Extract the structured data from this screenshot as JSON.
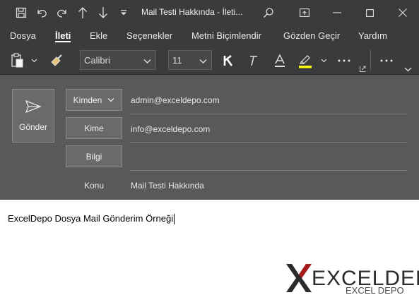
{
  "window": {
    "title": "Mail Testi Hakkında  -  İleti..."
  },
  "menu": {
    "tabs": [
      "Dosya",
      "İleti",
      "Ekle",
      "Seçenekler",
      "Metni Biçimlendir",
      "Gözden Geçir",
      "Yardım"
    ],
    "active": "İleti"
  },
  "ribbon": {
    "font_name": "Calibri",
    "font_size": "11",
    "highlight_color": "#ffff00"
  },
  "header": {
    "send_label": "Gönder",
    "from_label": "Kimden",
    "to_label": "Kime",
    "cc_label": "Bilgi",
    "subject_label": "Konu",
    "from_value": "admin@exceldepo.com",
    "to_value": "info@exceldepo.com",
    "cc_value": "",
    "subject_value": "Mail Testi Hakkında"
  },
  "body": {
    "text": "ExcelDepo Dosya Mail Gönderim Örneği"
  },
  "logo": {
    "text": "EXCELDEPO",
    "sub": "EXCEL DEPO"
  },
  "colors": {
    "titlebar": "#3b3b3b",
    "header": "#595959",
    "logo_x": "#a61c1c",
    "logo_text": "#2b2b2b"
  }
}
